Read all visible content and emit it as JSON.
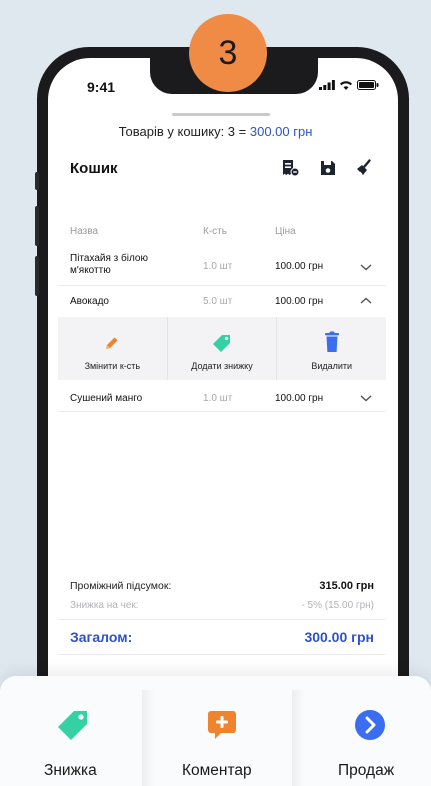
{
  "step_badge": "3",
  "status_bar": {
    "time": "9:41"
  },
  "cart": {
    "summary_prefix": "Товарів у кошику: 3 = ",
    "summary_amount": "300.00 грн",
    "title": "Кошик",
    "columns": {
      "name": "Назва",
      "qty": "К-сть",
      "price": "Ціна"
    },
    "items": [
      {
        "name": "Пітахайя з білою м'якоттю",
        "qty": "1.0 шт",
        "price": "100.00 грн",
        "expanded": false
      },
      {
        "name": "Авокадо",
        "qty": "5.0 шт",
        "price": "100.00 грн",
        "expanded": true
      },
      {
        "name": "Сушений манго",
        "qty": "1.0 шт",
        "price": "100.00 грн",
        "expanded": false
      }
    ],
    "actions": {
      "change_qty": "Змінити к-сть",
      "add_discount": "Додати знижку",
      "delete": "Видалити"
    },
    "totals": {
      "subtotal_label": "Проміжний підсумок:",
      "subtotal_value": "315.00 грн",
      "discount_label": "Знижка на чек:",
      "discount_value": "- 5% (15.00 грн)",
      "total_label": "Загалом:",
      "total_value": "300.00 грн"
    }
  },
  "bottom_bar": {
    "discount": "Знижка",
    "comment": "Коментар",
    "sale": "Продаж"
  },
  "colors": {
    "accent_blue": "#2c53c9",
    "teal": "#35d1a5",
    "orange": "#f0832e",
    "delete_blue": "#3a6df0",
    "badge": "#f08b45"
  },
  "icons": [
    "receipt-icon",
    "save-icon",
    "broom-icon",
    "chevron-down-icon",
    "chevron-up-icon",
    "pencil-icon",
    "tag-icon",
    "trash-icon",
    "comment-plus-icon",
    "arrow-right-circle-icon"
  ]
}
